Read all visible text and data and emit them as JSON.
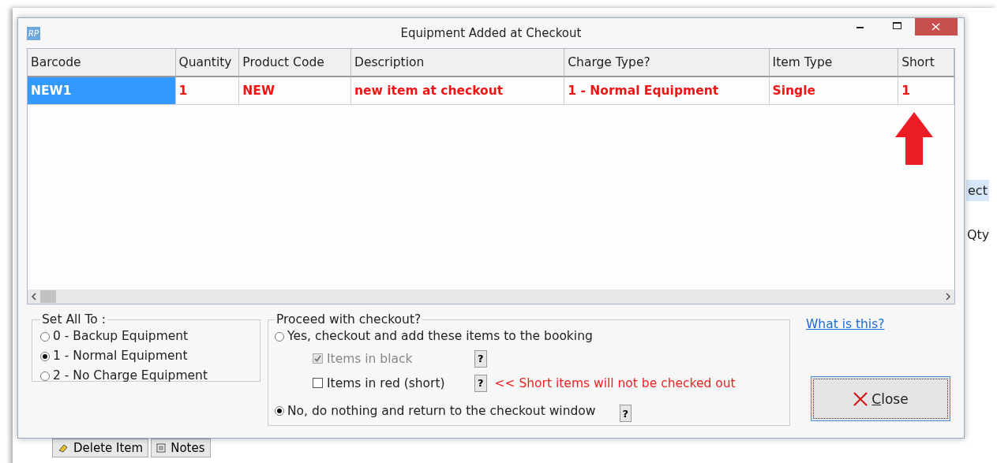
{
  "background_window": {
    "fragments": [
      "ect",
      "Qty"
    ],
    "buttons": [
      {
        "label": "Delete Item"
      },
      {
        "label": "Notes"
      }
    ]
  },
  "window": {
    "icon": "RP",
    "title": "Equipment Added at Checkout"
  },
  "table": {
    "columns": [
      "Barcode",
      "Quantity",
      "Product Code",
      "Description",
      "Charge Type?",
      "Item Type",
      "Short"
    ],
    "rows": [
      {
        "selected": true,
        "short": true,
        "cells": [
          "NEW1",
          "1",
          "NEW",
          "new item at checkout",
          "1  - Normal Equipment",
          "Single",
          "1"
        ]
      }
    ]
  },
  "set_all_to": {
    "title": "Set All To :",
    "options": [
      {
        "label": "0  - Backup Equipment",
        "selected": false
      },
      {
        "label": "1  - Normal Equipment",
        "selected": true
      },
      {
        "label": "2  - No Charge Equipment",
        "selected": false
      }
    ]
  },
  "proceed": {
    "title": "Proceed with checkout?",
    "yes": {
      "label": "Yes, checkout and add these items to the booking",
      "selected": false
    },
    "checks": [
      {
        "label": "Items in black",
        "checked": true,
        "disabled": true,
        "help": "?"
      },
      {
        "label": "Items in red (short)",
        "checked": false,
        "disabled": false,
        "help": "?",
        "note": "<< Short items will not be checked out"
      }
    ],
    "no": {
      "label": "No, do nothing and return to the checkout window",
      "selected": true,
      "help": "?"
    }
  },
  "help_link": "What is this?",
  "close_button": {
    "label": "Close"
  }
}
